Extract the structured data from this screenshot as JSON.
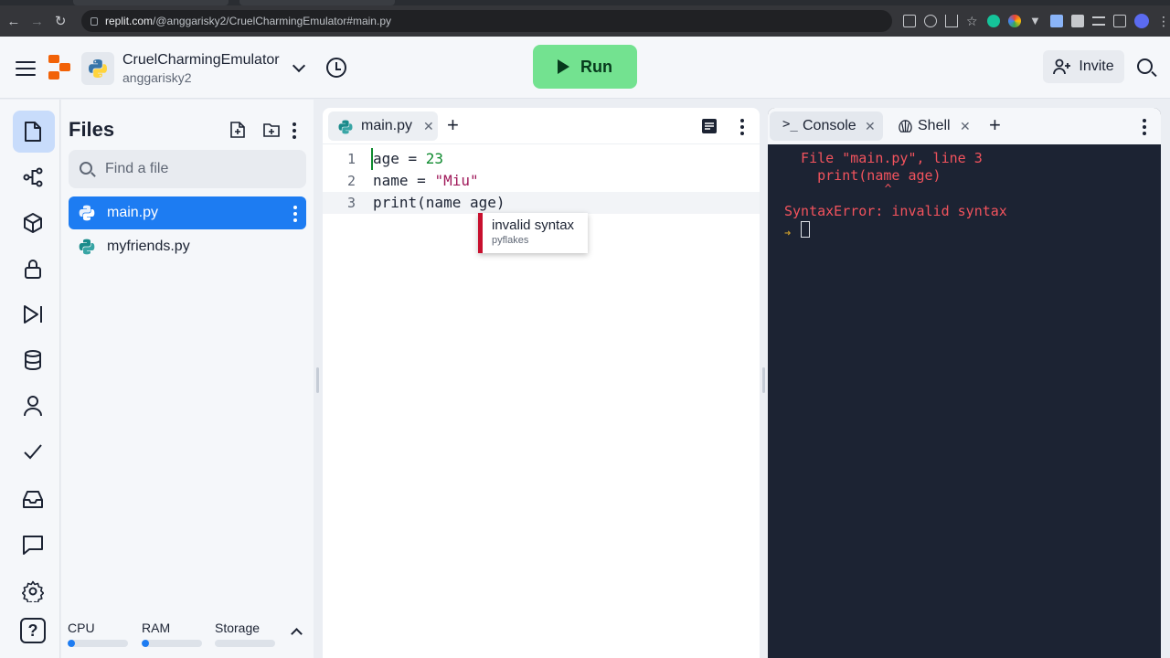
{
  "browser": {
    "url_host": "replit.com",
    "url_path": "/@anggarisky2/CruelCharmingEmulator#main.py"
  },
  "header": {
    "repl_name": "CruelCharmingEmulator",
    "owner": "anggarisky2",
    "run_label": "Run",
    "invite_label": "Invite",
    "run_color": "#73e290"
  },
  "files_panel": {
    "title": "Files",
    "search_placeholder": "Find a file",
    "files": [
      {
        "name": "main.py",
        "selected": true
      },
      {
        "name": "myfriends.py",
        "selected": false
      }
    ],
    "resources": [
      {
        "label": "CPU",
        "fill": 0.12
      },
      {
        "label": "RAM",
        "fill": 0.12
      },
      {
        "label": "Storage",
        "fill": 0.0
      }
    ]
  },
  "editor": {
    "tab_label": "main.py",
    "lines": [
      {
        "num": "1",
        "text": "age = 23"
      },
      {
        "num": "2",
        "text": "name = \"Miu\""
      },
      {
        "num": "3",
        "text": "print(name age)"
      }
    ],
    "diagnostic": {
      "message": "invalid syntax",
      "source": "pyflakes"
    }
  },
  "console": {
    "tabs": [
      {
        "label": "Console",
        "active": true
      },
      {
        "label": "Shell",
        "active": false
      }
    ],
    "output": [
      "  File \"main.py\", line 3",
      "    print(name age)",
      "              ^",
      "SyntaxError: invalid syntax"
    ],
    "error_color": "#f2535d"
  },
  "icons": {
    "rail": [
      "files-icon",
      "git-icon",
      "packages-icon",
      "secrets-icon",
      "debugger-icon",
      "database-icon",
      "auth-icon",
      "tests-icon",
      "inbox-icon",
      "chat-icon",
      "settings-icon",
      "help-icon"
    ]
  }
}
